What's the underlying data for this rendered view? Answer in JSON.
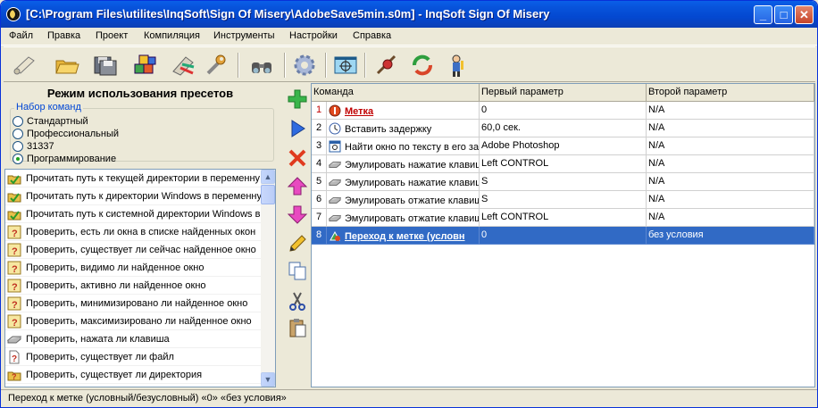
{
  "window": {
    "title": "[C:\\Program Files\\utilites\\InqSoft\\Sign Of Misery\\AdobeSave5min.s0m] - InqSoft Sign Of Misery",
    "minimize": "_",
    "maximize": "□",
    "close": "✕"
  },
  "menu": [
    "Файл",
    "Правка",
    "Проект",
    "Компиляция",
    "Инструменты",
    "Настройки",
    "Справка"
  ],
  "toolbar": {
    "icons": [
      "scroll-icon",
      "open-folder-icon",
      "save-disk-icon",
      "compile-blocks-icon",
      "paint-icon",
      "wrench-icon",
      "binoculars-icon",
      "gear-icon",
      "target-window-icon",
      "sniper-icon",
      "refresh-icon",
      "person-icon"
    ]
  },
  "presets": {
    "title": "Режим использования пресетов",
    "group_title": "Набор команд",
    "options": [
      "Стандартный",
      "Профессиональный",
      "31337",
      "Программирование"
    ],
    "selected": "Программирование"
  },
  "command_list": [
    {
      "label": "Прочитать путь к текущей директории в переменну",
      "icon": "folder-check-icon"
    },
    {
      "label": "Прочитать путь к директории Windows в переменну",
      "icon": "folder-check-icon"
    },
    {
      "label": "Прочитать путь к системной директории Windows в",
      "icon": "folder-check-icon"
    },
    {
      "label": "Проверить, есть ли окна в списке найденных окон",
      "icon": "question-window-icon"
    },
    {
      "label": "Проверить, существует ли сейчас найденное окно",
      "icon": "question-window-icon"
    },
    {
      "label": "Проверить, видимо ли найденное окно",
      "icon": "question-window-icon"
    },
    {
      "label": "Проверить, активно ли найденное окно",
      "icon": "question-window-icon"
    },
    {
      "label": "Проверить, минимизировано ли найденное окно",
      "icon": "question-window-icon"
    },
    {
      "label": "Проверить, максимизировано ли найденное окно",
      "icon": "question-window-icon"
    },
    {
      "label": "Проверить, нажата ли клавиша",
      "icon": "keyboard-icon"
    },
    {
      "label": "Проверить, существует ли файл",
      "icon": "question-file-icon"
    },
    {
      "label": "Проверить, существует ли директория",
      "icon": "question-folder-icon"
    }
  ],
  "side_buttons": [
    "add-icon",
    "play-icon",
    "delete-icon",
    "move-up-icon",
    "move-down-icon",
    "edit-pencil-icon",
    "copy-icon",
    "cut-scissors-icon",
    "paste-icon"
  ],
  "grid": {
    "columns": [
      "Команда",
      "Первый параметр",
      "Второй параметр"
    ],
    "rows": [
      {
        "num": "1",
        "cmd": "Метка",
        "p1": "0",
        "p2": "N/A",
        "icon": "label-icon",
        "style": "label"
      },
      {
        "num": "2",
        "cmd": "Вставить задержку",
        "p1": "60,0 сек.",
        "p2": "N/A",
        "icon": "clock-icon"
      },
      {
        "num": "3",
        "cmd": "Найти окно по тексту в его за",
        "p1": "Adobe Photoshop",
        "p2": "N/A",
        "icon": "find-window-icon"
      },
      {
        "num": "4",
        "cmd": "Эмулировать нажатие клавиш",
        "p1": "Left CONTROL",
        "p2": "N/A",
        "icon": "keyboard-icon"
      },
      {
        "num": "5",
        "cmd": "Эмулировать нажатие клавиш",
        "p1": "S",
        "p2": "N/A",
        "icon": "keyboard-icon"
      },
      {
        "num": "6",
        "cmd": "Эмулировать отжатие клавиш",
        "p1": "S",
        "p2": "N/A",
        "icon": "keyboard-icon"
      },
      {
        "num": "7",
        "cmd": "Эмулировать отжатие клавиш",
        "p1": "Left CONTROL",
        "p2": "N/A",
        "icon": "keyboard-icon"
      },
      {
        "num": "8",
        "cmd": "Переход к метке (условн",
        "p1": "0",
        "p2": "без условия",
        "icon": "jump-icon",
        "style": "selected"
      }
    ]
  },
  "status": "Переход к метке (условный/безусловный)  «0»  «без условия»"
}
